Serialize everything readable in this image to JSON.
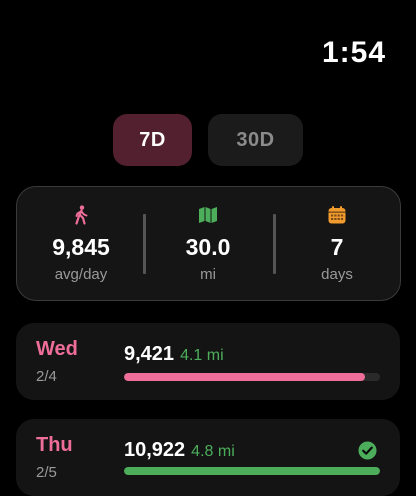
{
  "status": {
    "time": "1:54"
  },
  "range_selector": {
    "options": [
      {
        "label": "7D",
        "selected": true
      },
      {
        "label": "30D",
        "selected": false
      }
    ]
  },
  "summary": {
    "steps": {
      "icon": "walking-figure-icon",
      "value": "9,845",
      "unit": "avg/day",
      "color": "#ef6e99"
    },
    "distance": {
      "icon": "map-icon",
      "value": "30.0",
      "unit": "mi",
      "color": "#4cae5b"
    },
    "days": {
      "icon": "calendar-icon",
      "value": "7",
      "unit": "days",
      "color": "#f19a2d"
    }
  },
  "days": [
    {
      "day": "Wed",
      "date": "2/4",
      "steps": "9,421",
      "distance": "4.1 mi",
      "progress": 0.94,
      "goal_met": false,
      "bar_color": "#ef6e99"
    },
    {
      "day": "Thu",
      "date": "2/5",
      "steps": "10,922",
      "distance": "4.8 mi",
      "progress": 1.0,
      "goal_met": true,
      "bar_color": "#4cae5b",
      "check_icon": "checkmark-circle-icon"
    }
  ]
}
